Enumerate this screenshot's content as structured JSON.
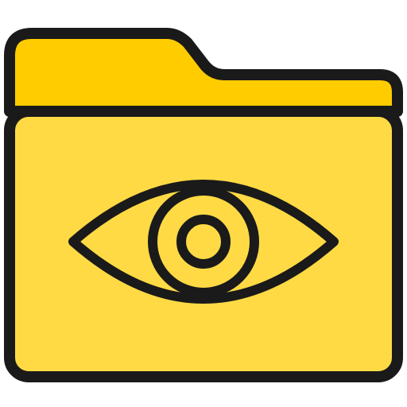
{
  "icon": {
    "name": "folder-eye-icon",
    "parts": [
      "folder-back-icon",
      "folder-front-icon",
      "eye-icon"
    ]
  },
  "colors": {
    "background": "#ffffff",
    "folder_back": "#ffcc00",
    "folder_front": "#ffda44",
    "outline": "#1a1a1a"
  }
}
